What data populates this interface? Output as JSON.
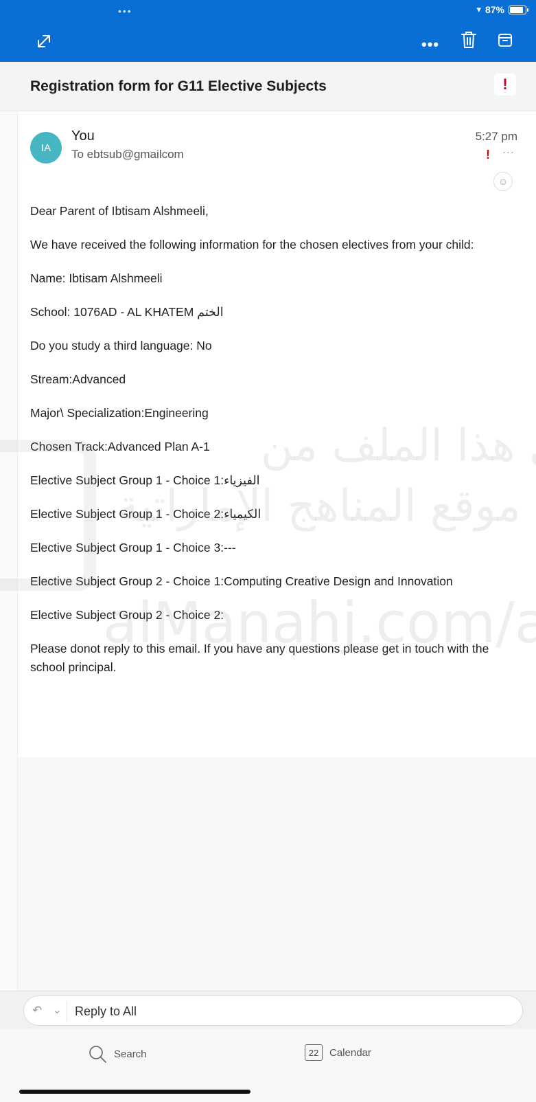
{
  "status": {
    "battery": "87%"
  },
  "email": {
    "subject": "Registration form for G11 Elective Subjects",
    "avatar_initials": "IA",
    "sender": "You",
    "recipient": "To ebtsub@gmailcom",
    "time": "5:27 pm",
    "body": [
      "Dear Parent of Ibtisam Alshmeeli,",
      "We have received the following information for the chosen electives from your child:",
      "Name: Ibtisam Alshmeeli",
      "School: 1076AD - AL KHATEM الختم",
      "Do you study a third language: No",
      "Stream:Advanced",
      "Major\\ Specialization:Engineering",
      "Chosen Track:Advanced Plan A-1",
      "Elective Subject Group 1 - Choice 1:الفيزياء",
      "Elective Subject Group 1 - Choice 2:الكيمياء",
      "Elective Subject Group 1 - Choice 3:---",
      "Elective Subject Group 2 - Choice 1:Computing Creative Design and Innovation",
      "Elective Subject Group 2 - Choice 2:",
      "Please donot reply to this email. If you have any questions please get in touch with the school principal."
    ]
  },
  "watermark": {
    "line1": "تم تحميل هذا الملف من",
    "line2": "موقع المناهج الإماراتية",
    "line3": "alManahj.com/ae"
  },
  "reply": {
    "label": "Reply to All"
  },
  "tabs": {
    "search": "Search",
    "calendar_day": "22",
    "calendar": "Calendar"
  },
  "icons": [
    "expand-icon",
    "more-icon",
    "trash-icon",
    "archive-icon",
    "flag-icon",
    "reply-all-icon",
    "search-icon",
    "calendar-icon",
    "emoji-icon"
  ]
}
